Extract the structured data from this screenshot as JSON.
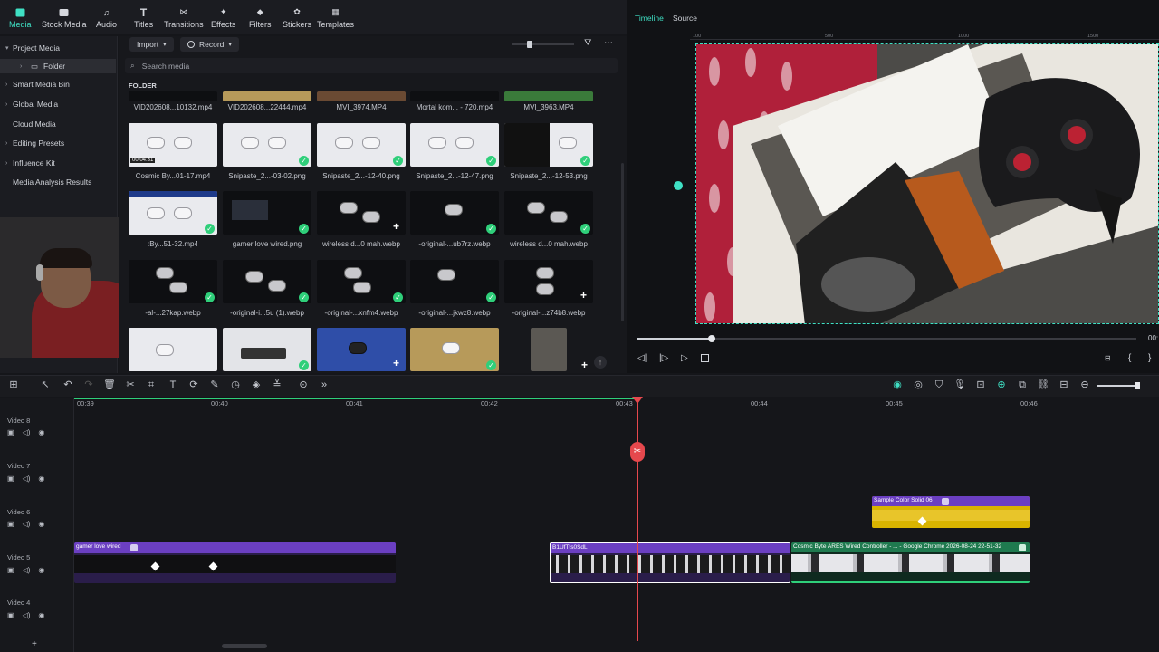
{
  "toolbar": {
    "items": [
      {
        "label": "Media",
        "icon": "media-icon"
      },
      {
        "label": "Stock Media",
        "icon": "stock-media-icon"
      },
      {
        "label": "Audio",
        "icon": "audio-icon"
      },
      {
        "label": "Titles",
        "icon": "titles-icon"
      },
      {
        "label": "Transitions",
        "icon": "transitions-icon"
      },
      {
        "label": "Effects",
        "icon": "effects-icon"
      },
      {
        "label": "Filters",
        "icon": "filters-icon"
      },
      {
        "label": "Stickers",
        "icon": "stickers-icon"
      },
      {
        "label": "Templates",
        "icon": "templates-icon"
      }
    ]
  },
  "sidebar": {
    "items": [
      {
        "label": "Project Media"
      },
      {
        "label": "Folder"
      },
      {
        "label": "Smart Media Bin"
      },
      {
        "label": "Global Media"
      },
      {
        "label": "Cloud Media"
      },
      {
        "label": "Editing Presets"
      },
      {
        "label": "Influence Kit"
      },
      {
        "label": "Media Analysis Results"
      }
    ]
  },
  "media": {
    "import_label": "Import",
    "record_label": "Record",
    "search_placeholder": "Search media",
    "folder_label": "FOLDER",
    "row0": [
      "VID202608...10132.mp4",
      "VID202608...22444.mp4",
      "MVI_3974.MP4",
      "Mortal kom... - 720.mp4",
      "MVI_3963.MP4"
    ],
    "row1": [
      "Cosmic By...01-17.mp4",
      "Snipaste_2...-03-02.png",
      "Snipaste_2...-12-40.png",
      "Snipaste_2...-12-47.png",
      "Snipaste_2...-12-53.png"
    ],
    "row2": [
      ":By...51-32.mp4",
      "gamer love wired.png",
      "wireless d...0 mah.webp",
      "-original-...ub7rz.webp",
      "wireless d...0 mah.webp"
    ],
    "row3": [
      "-al-...27kap.webp",
      "-original-i...5u (1).webp",
      "-original-...xnfm4.webp",
      "-original-...jkwz8.webp",
      "-original-...z74b8.webp"
    ],
    "thumb_time": "00:04:31"
  },
  "player": {
    "tab_timeline": "Timeline",
    "tab_source": "Source",
    "ruler_marks": [
      "100",
      "500",
      "1000",
      "1500"
    ],
    "time_partial": "00:"
  },
  "timeline": {
    "ticks": [
      "00:39",
      "00:40",
      "00:41",
      "00:42",
      "00:43",
      "00:44",
      "00:45",
      "00:46"
    ],
    "tracks": [
      "Video 8",
      "Video 7",
      "Video 6",
      "Video 5",
      "Video 4"
    ],
    "clips": {
      "gamer": "gamer love wired",
      "b1": "B1UfTts0SdL",
      "cosmic": "Cosmic Byte ARES Wired Controller - ... - Google Chrome 2026-08-24 22-51-32",
      "solid": "Sample Color Solid 06"
    },
    "playhead_color": "#e5484d",
    "accent": "#3fe0c4",
    "clip_purple": "#6b3fc2"
  }
}
